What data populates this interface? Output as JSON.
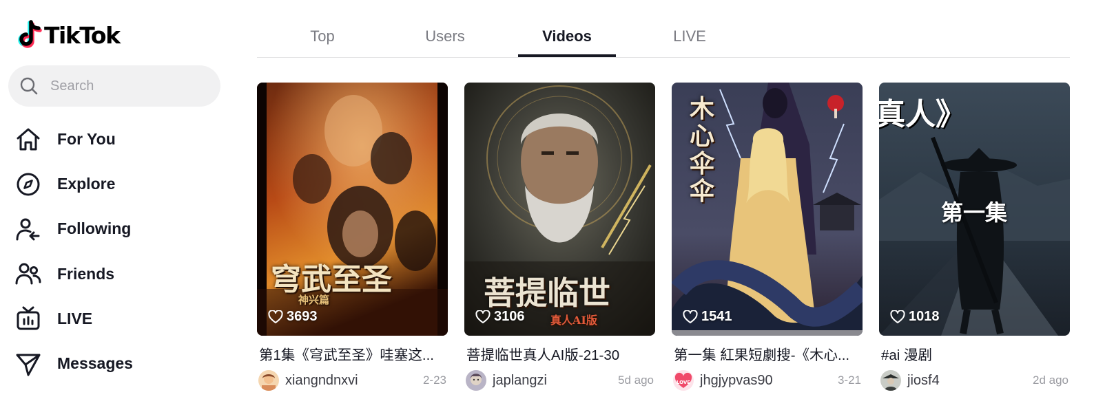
{
  "brand": {
    "name": "TikTok",
    "colors": {
      "cyan": "#25F4EE",
      "red": "#FE2C55",
      "text": "#161823"
    }
  },
  "search": {
    "placeholder": "Search",
    "icon": "search-icon"
  },
  "sidebar": {
    "items": [
      {
        "label": "For You",
        "icon": "home-icon"
      },
      {
        "label": "Explore",
        "icon": "compass-icon"
      },
      {
        "label": "Following",
        "icon": "following-icon"
      },
      {
        "label": "Friends",
        "icon": "friends-icon"
      },
      {
        "label": "LIVE",
        "icon": "live-tv-icon"
      },
      {
        "label": "Messages",
        "icon": "send-icon"
      }
    ]
  },
  "tabs": [
    {
      "label": "Top",
      "active": false
    },
    {
      "label": "Users",
      "active": false
    },
    {
      "label": "Videos",
      "active": true
    },
    {
      "label": "LIVE",
      "active": false
    }
  ],
  "videos": [
    {
      "overlay": "穹武至圣",
      "overlay_sub": "神兴篇",
      "likes": "3693",
      "caption": "第1集《穹武至圣》哇塞这...",
      "author": "xiangndnxvi",
      "date": "2-23"
    },
    {
      "overlay": "菩提临世",
      "overlay_sub": "真人AI版",
      "likes": "3106",
      "caption": "菩提临世真人AI版-21-30",
      "author": "japlangzi",
      "date": "5d ago"
    },
    {
      "overlay": "木心伞伞",
      "overlay_sub": "",
      "likes": "1541",
      "caption": "第一集 紅果短劇搜-《木心...",
      "author": "jhgjypvas90",
      "date": "3-21"
    },
    {
      "overlay": "第一集",
      "overlay_sub": "真人》",
      "likes": "1018",
      "caption": "#ai 漫剧",
      "author": "jiosf4",
      "date": "2d ago"
    }
  ]
}
